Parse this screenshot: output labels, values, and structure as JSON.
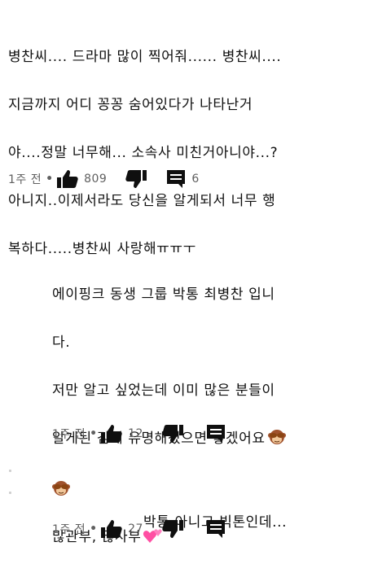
{
  "comments": [
    {
      "lines": [
        "병찬씨.... 드라마 많이 찍어줘...... 병찬씨....",
        "지금까지 어디 꽁꽁 숨어있다가 나타난거",
        "야....정말 너무해... 소속사 미친거아니야...?",
        "아니지..이제서라도 당신을 알게되서 너무 행",
        "복하다.....병찬씨 사랑해ㅠㅠㅜ"
      ],
      "time": "1주 전",
      "likes": "809",
      "replies": "6"
    },
    {
      "lines": [
        "에이핑크 동생 그룹 박통 최병찬 입니",
        "다.",
        "저만 알고 싶었는데 이미 많은 분들이",
        "알게된 김에 유명해졌으면 좋겠어요"
      ],
      "line5": "많관부, 많사부",
      "time": "1주 전",
      "likes": "12",
      "replies": ""
    },
    {
      "lines": [
        "박통 아니고 빅톤인데..."
      ],
      "time": "1주 전",
      "likes": "27",
      "replies": ""
    }
  ],
  "icons": {
    "like": "thumb-up-icon",
    "dislike": "thumb-down-icon",
    "reply": "comment-icon",
    "monkey": "see-no-evil-monkey-emoji",
    "hearts": "two-hearts-emoji"
  },
  "colors": {
    "text": "#0f0f0f",
    "meta": "#606060",
    "icon": "#0f0f0f",
    "heart": "#ff4fa3"
  }
}
